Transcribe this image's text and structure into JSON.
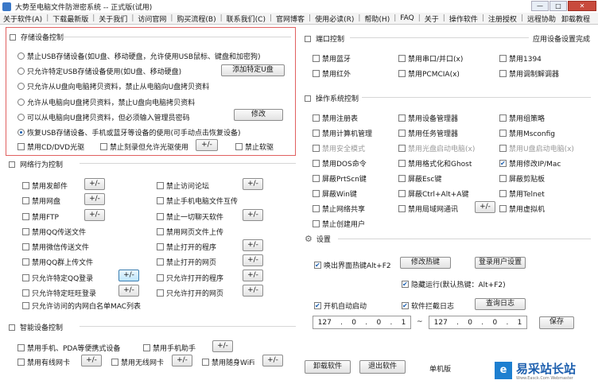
{
  "window": {
    "title": "大势至电脑文件防泄密系统 -- 正式版(试用)",
    "controls": [
      "—",
      "□",
      "✕"
    ]
  },
  "menu": {
    "items": [
      "关于软件(A)",
      "下载最新版",
      "关于我们",
      "访问官网",
      "购买流程(B)",
      "联系我们(C)",
      "官网博客",
      "使用必读(R)",
      "帮助(H)",
      "FAQ",
      "关于",
      "操作软件",
      "注册授权",
      "远程协助"
    ],
    "right": "卸载教程"
  },
  "storage": {
    "title": "存储设备控制",
    "options": [
      "禁止USB存储设备(如U盘、移动硬盘，允许使用USB鼠标、键盘和加密狗)",
      "只允许特定USB存储设备使用(如U盘、移动硬盘)",
      "只允许从U盘向电脑拷贝资料，禁止从电脑向U盘拷贝资料",
      "允许从电脑向U盘拷贝资料，禁止U盘向电脑拷贝资料",
      "可以从电脑向U盘拷贝资料，但必须输入管理员密码",
      "恢复USB存储设备、手机或蓝牙等设备的使用(可手动点击恢复设备)"
    ],
    "add_usb_button": "添加特定U盘",
    "modify_button": "修改",
    "checks": [
      "禁用CD/DVD光驱",
      "禁止刻录但允许光驱使用",
      "禁止软驱"
    ],
    "toggle": "+/-"
  },
  "network": {
    "title": "网络行为控制",
    "left": [
      "禁用发邮件",
      "禁用网盘",
      "禁用FTP",
      "禁用QQ传送文件",
      "禁用微信传送文件",
      "禁用QQ群上传文件",
      "只允许特定QQ登录",
      "只允许特定旺旺登录",
      "只允许访问的内网白名单MAC列表"
    ],
    "right": [
      "禁止访问论坛",
      "禁止手机电脑文件互传",
      "禁止一切聊天软件",
      "禁用网页文件上传",
      "禁止打开的程序",
      "禁止打开的网页",
      "只允许打开的程序",
      "只允许打开的网页"
    ],
    "toggle": "+/-"
  },
  "smart": {
    "title": "智能设备控制",
    "items": [
      "禁用手机、PDA等便携式设备",
      "禁用手机助手",
      "禁用有线网卡",
      "禁用无线网卡",
      "禁用随身WiFi"
    ],
    "toggle": "+/-"
  },
  "port": {
    "title": "端口控制",
    "link": "应用设备设置完成",
    "items": [
      "禁用蓝牙",
      "禁用串口/并口(x)",
      "禁用1394",
      "禁用红外",
      "禁用PCMCIA(x)",
      "禁用调制解调器"
    ]
  },
  "os": {
    "title": "操作系统控制",
    "items": [
      {
        "label": "禁用注册表",
        "checked": false,
        "disabled": false
      },
      {
        "label": "禁用设备管理器",
        "checked": false,
        "disabled": false
      },
      {
        "label": "禁用组策略",
        "checked": false,
        "disabled": false
      },
      {
        "label": "禁用计算机管理",
        "checked": false,
        "disabled": false
      },
      {
        "label": "禁用任务管理器",
        "checked": false,
        "disabled": false
      },
      {
        "label": "禁用Msconfig",
        "checked": false,
        "disabled": false
      },
      {
        "label": "禁用安全模式",
        "checked": false,
        "disabled": true
      },
      {
        "label": "禁用光盘启动电脑(x)",
        "checked": false,
        "disabled": true
      },
      {
        "label": "禁用U盘启动电脑(x)",
        "checked": false,
        "disabled": true
      },
      {
        "label": "禁用DOS命令",
        "checked": false,
        "disabled": false
      },
      {
        "label": "禁用格式化和Ghost",
        "checked": false,
        "disabled": false
      },
      {
        "label": "禁用修改IP/Mac",
        "checked": true,
        "disabled": false
      },
      {
        "label": "屏蔽PrtScn键",
        "checked": false,
        "disabled": false
      },
      {
        "label": "屏蔽Esc键",
        "checked": false,
        "disabled": false
      },
      {
        "label": "屏蔽剪贴板",
        "checked": false,
        "disabled": false
      },
      {
        "label": "屏蔽Win键",
        "checked": false,
        "disabled": false
      },
      {
        "label": "屏蔽Ctrl+Alt+A键",
        "checked": false,
        "disabled": false
      },
      {
        "label": "禁用Telnet",
        "checked": false,
        "disabled": false
      },
      {
        "label": "禁止网络共享",
        "checked": false,
        "disabled": false
      },
      {
        "label": "禁用局域网通讯",
        "checked": false,
        "disabled": false
      },
      {
        "label": "禁用虚拟机",
        "checked": false,
        "disabled": false
      },
      {
        "label": "禁止创建用户",
        "checked": false,
        "disabled": false
      }
    ],
    "toggle": "+/-"
  },
  "settings": {
    "title": "设置",
    "hotkey": "唤出界面热键Alt+F2",
    "modify_hotkey_button": "修改热键",
    "login_user_button": "登录用户设置",
    "hidden_run": "隐藏运行(默认热键：Alt+F2)",
    "autostart": "开机自动启动",
    "intercept_log": "软件拦截日志",
    "view_log_button": "查询日志",
    "ip_from": [
      "127",
      "0",
      "0",
      "1"
    ],
    "ip_to": [
      "127",
      "0",
      "0",
      "1"
    ],
    "ip_separator": "~",
    "save_button": "保存"
  },
  "footer": {
    "uninstall_button": "卸载软件",
    "exit_button": "退出软件",
    "edition": "单机版"
  },
  "watermark": {
    "icon_char": "e",
    "text": "易采站长站",
    "sub": "Www.Easck.Com Webmaster"
  }
}
